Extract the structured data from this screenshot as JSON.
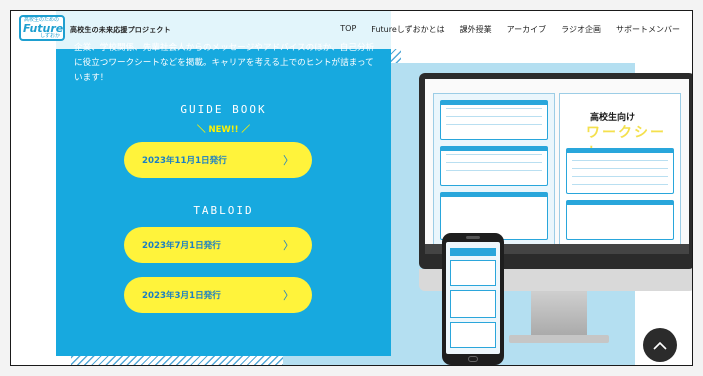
{
  "header": {
    "logo": {
      "top_text": "高校生のための",
      "main_text": "Future",
      "bottom_text": "しずおか"
    },
    "brand_name": "高校生の未来応援プロジェクト",
    "menu": [
      {
        "label": "TOP"
      },
      {
        "label": "Futureしずおかとは"
      },
      {
        "label": "課外授業"
      },
      {
        "label": "アーカイブ"
      },
      {
        "label": "ラジオ企画"
      },
      {
        "label": "サポートメンバー"
      }
    ]
  },
  "main": {
    "intro_text": "企業、学校関係、先輩社会人からのメッセージやアドバイスのほか、自己分析に役立つワークシートなどを掲載。キャリアを考える上でのヒントが詰まっています！",
    "guide_book": {
      "title": "GUIDE BOOK",
      "badge": "＼ NEW!! ／",
      "items": [
        {
          "label": "2023年11月1日発行",
          "arrow": "〉"
        }
      ]
    },
    "tabloid": {
      "title": "TABLOID",
      "items": [
        {
          "label": "2023年7月1日発行",
          "arrow": "〉"
        },
        {
          "label": "2023年3月1日発行",
          "arrow": "〉"
        }
      ]
    }
  },
  "preview": {
    "worksheet_title": "高校生向け",
    "worksheet_subtitle": "ワークシート"
  },
  "icons": {
    "scroll_top": "chevron-up-icon"
  },
  "colors": {
    "panel_blue": "#17a9df",
    "button_yellow": "#fff33b",
    "button_text": "#1a7fc5",
    "new_badge": "#fff200",
    "light_blue": "#b4dff1"
  }
}
